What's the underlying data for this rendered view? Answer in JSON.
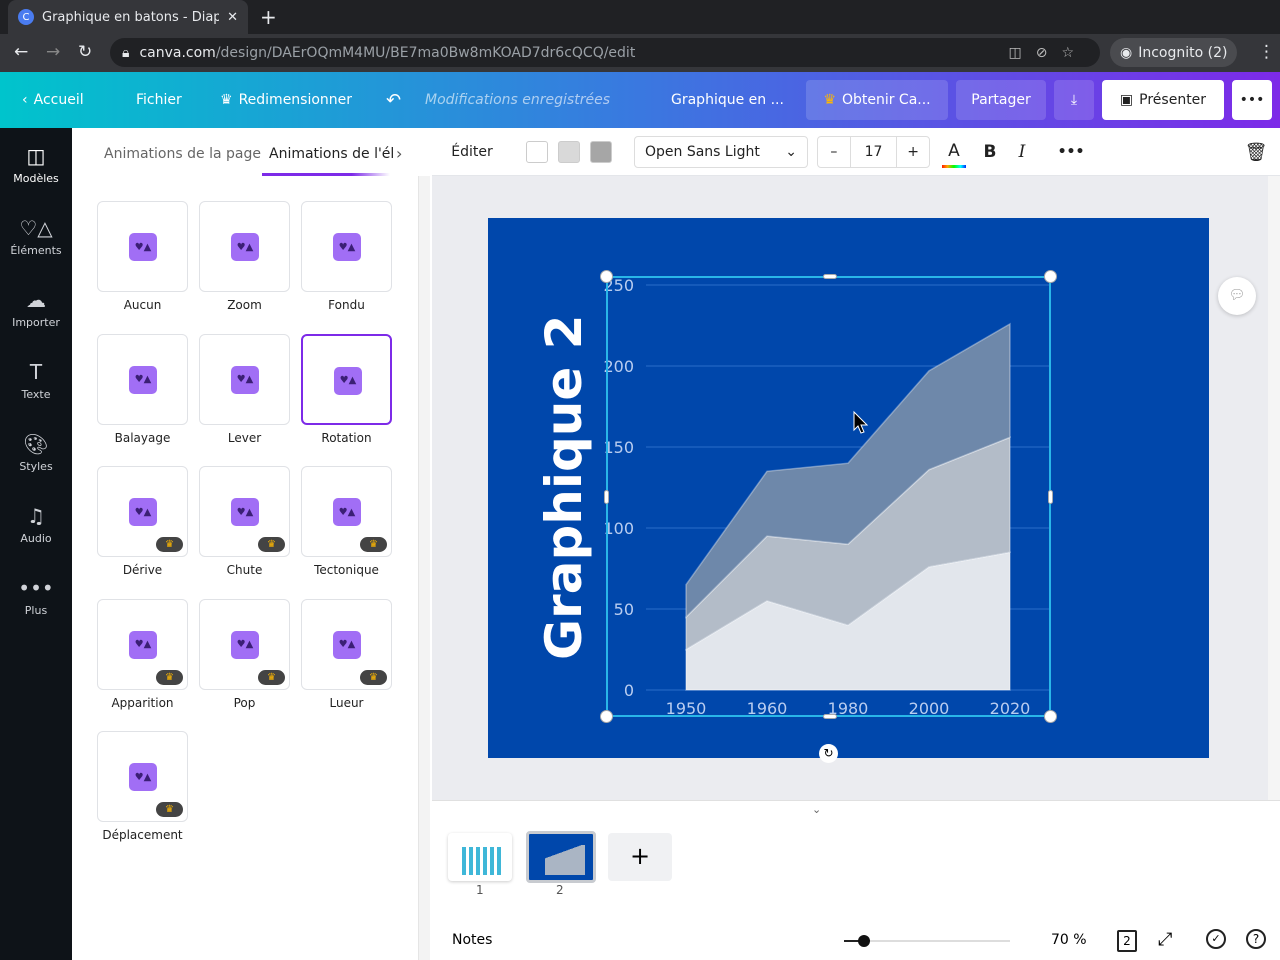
{
  "browser": {
    "tab_title": "Graphique en batons - Diaporama",
    "url_host": "canva.com",
    "url_path": "/design/DAErOQmM4MU/BE7ma0Bw8mKOAD7dr6cQCQ/edit",
    "profile": "Incognito (2)"
  },
  "header": {
    "home": "Accueil",
    "file": "Fichier",
    "resize": "Redimensionner",
    "saved": "Modifications enregistrées",
    "doc_title": "Graphique en ...",
    "pro": "Obtenir Ca...",
    "share": "Partager",
    "present": "Présenter"
  },
  "rail": [
    {
      "label": "Modèles",
      "icon": "template-icon"
    },
    {
      "label": "Éléments",
      "icon": "shapes-icon"
    },
    {
      "label": "Importer",
      "icon": "upload-cloud-icon"
    },
    {
      "label": "Texte",
      "icon": "text-icon"
    },
    {
      "label": "Styles",
      "icon": "palette-icon"
    },
    {
      "label": "Audio",
      "icon": "music-icon"
    },
    {
      "label": "Plus",
      "icon": "more-icon"
    }
  ],
  "panel": {
    "tabs": [
      "Animations de la page",
      "Animations de l'élément"
    ],
    "animations": [
      {
        "label": "Aucun",
        "pro": false
      },
      {
        "label": "Zoom",
        "pro": false
      },
      {
        "label": "Fondu",
        "pro": false
      },
      {
        "label": "Balayage",
        "pro": false
      },
      {
        "label": "Lever",
        "pro": false
      },
      {
        "label": "Rotation",
        "pro": false,
        "selected": true
      },
      {
        "label": "Dérive",
        "pro": true
      },
      {
        "label": "Chute",
        "pro": true
      },
      {
        "label": "Tectonique",
        "pro": true
      },
      {
        "label": "Apparition",
        "pro": true
      },
      {
        "label": "Pop",
        "pro": true
      },
      {
        "label": "Lueur",
        "pro": true
      },
      {
        "label": "Déplacement",
        "pro": true
      }
    ]
  },
  "toolbar": {
    "edit": "Éditer",
    "swatches": [
      "#ffffff",
      "#d9d9d9",
      "#a6a6a6"
    ],
    "font": "Open Sans Light",
    "font_size": "17",
    "minus": "–",
    "plus": "+"
  },
  "slide": {
    "title": "Graphique 2",
    "background": "#0047ab"
  },
  "chart_data": {
    "type": "area",
    "stacked": true,
    "categories": [
      "1950",
      "1960",
      "1980",
      "2000",
      "2020"
    ],
    "series": [
      {
        "values": [
          25,
          55,
          40,
          76,
          85
        ],
        "color": "#e2e6ec"
      },
      {
        "values": [
          20,
          40,
          50,
          60,
          71
        ],
        "color": "#b3bcc8"
      },
      {
        "values": [
          20,
          40,
          50,
          61,
          70
        ],
        "color": "#6e88aa"
      }
    ],
    "yticks": [
      "0",
      "50",
      "100",
      "150",
      "200",
      "250"
    ],
    "ylim": [
      0,
      250
    ],
    "grid": true
  },
  "pages": {
    "thumbs": [
      "1",
      "2"
    ],
    "add": "+"
  },
  "footer": {
    "notes": "Notes",
    "zoom": "70 %",
    "zoom_value": 70,
    "page_count": "2"
  }
}
